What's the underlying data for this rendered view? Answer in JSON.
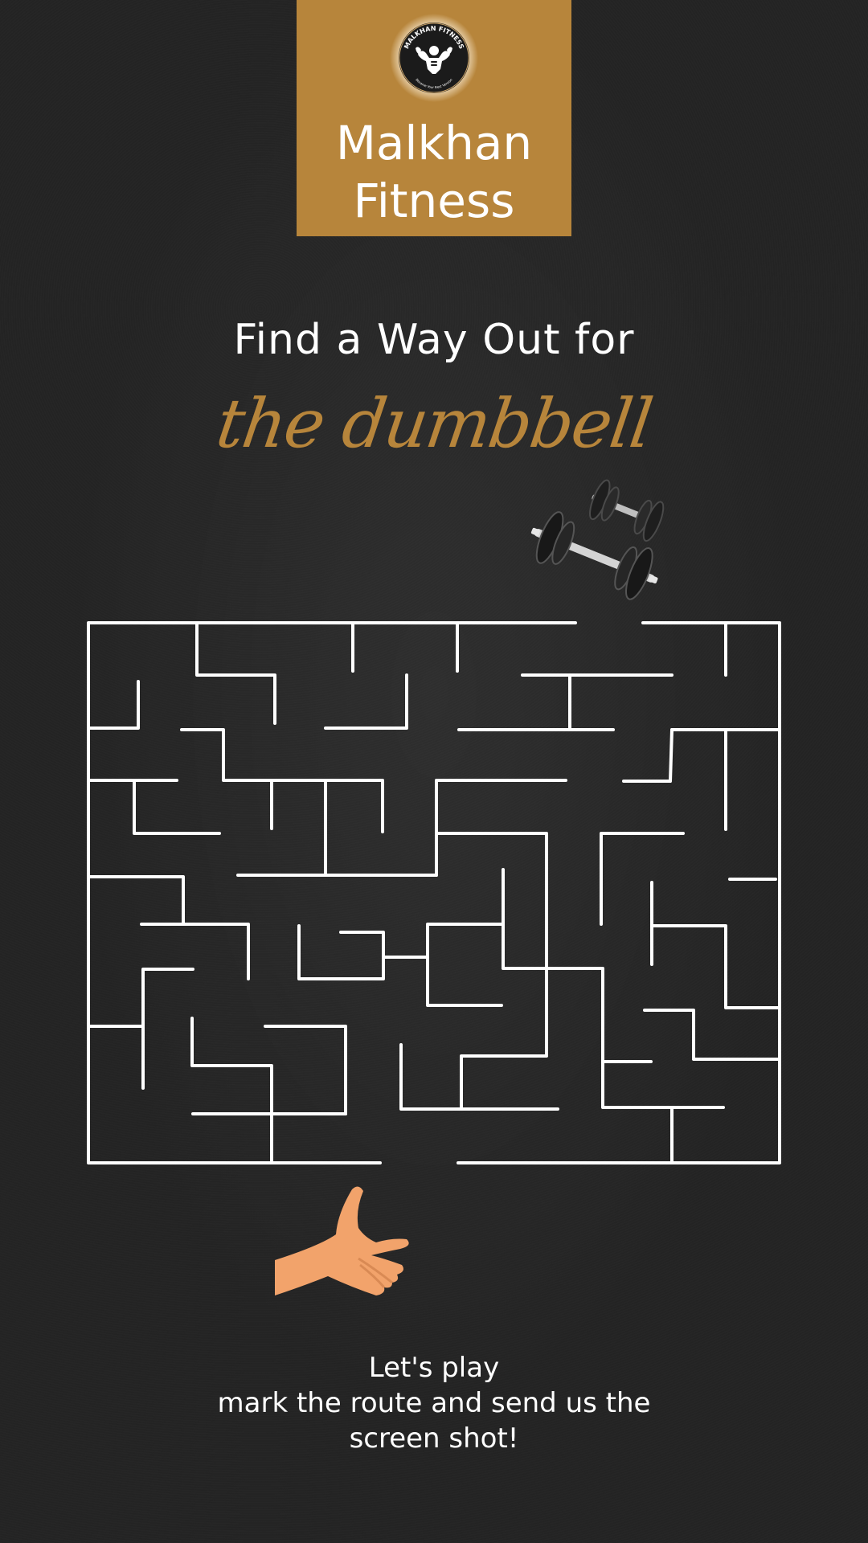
{
  "brand": {
    "name_line1": "Malkhan",
    "name_line2": "Fitness",
    "logo_text_top": "MALKHAN FITNESS",
    "logo_text_bottom": "Become Your Best Version",
    "color": "#b7853b"
  },
  "headline": {
    "line1": "Find a Way Out for",
    "line2": "the dumbbell",
    "script_color": "#b7853b"
  },
  "icons": {
    "logo": "bodybuilder-logo-icon",
    "goal": "dumbbell-icon",
    "start": "pointing-hand-icon"
  },
  "footer": {
    "line1": "Let's play",
    "line2": "mark the route and send us the",
    "line3": "screen shot!"
  },
  "colors": {
    "background": "#232323",
    "maze_lines": "#ffffff",
    "hand": "#f2a36b"
  }
}
